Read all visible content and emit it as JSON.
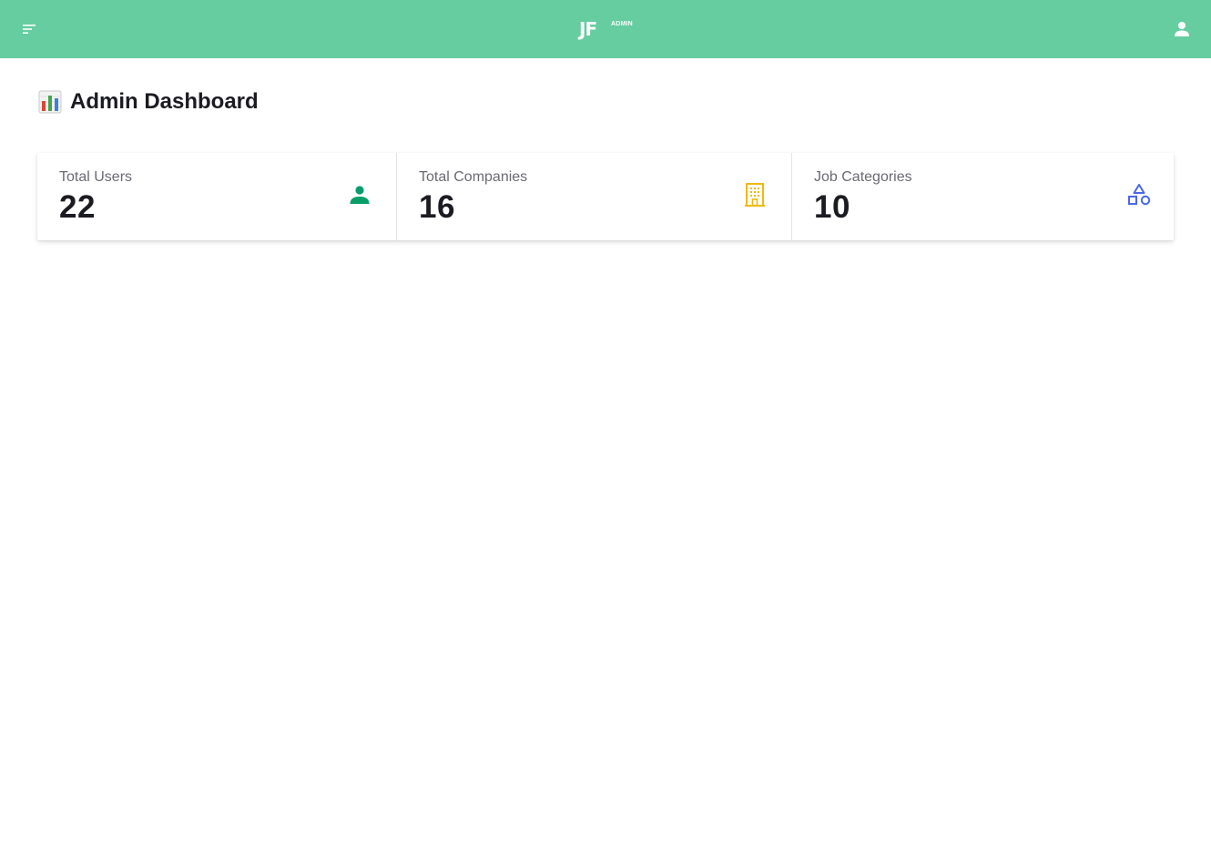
{
  "header": {
    "logo_text": "JF",
    "logo_badge": "ADMIN",
    "background_color": "#66cda0"
  },
  "page": {
    "title": "Admin Dashboard",
    "title_icon": "bar-chart-icon"
  },
  "stats": [
    {
      "label": "Total Users",
      "value": "22",
      "icon": "user-icon",
      "icon_color": "#0a9d6a"
    },
    {
      "label": "Total Companies",
      "value": "16",
      "icon": "building-icon",
      "icon_color": "#f2b80c"
    },
    {
      "label": "Job Categories",
      "value": "10",
      "icon": "shapes-icon",
      "icon_color": "#4a67e8"
    }
  ]
}
